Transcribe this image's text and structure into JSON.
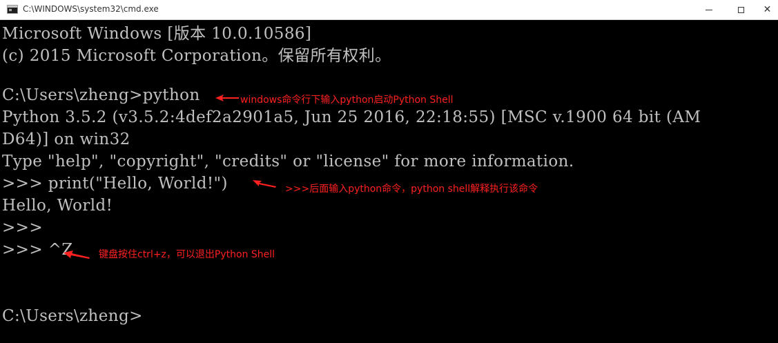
{
  "window": {
    "title": "C:\\WINDOWS\\system32\\cmd.exe",
    "minimize_glyph": "—",
    "maximize_glyph": "☐",
    "close_glyph": "✕"
  },
  "console": {
    "lines": [
      "Microsoft Windows [版本 10.0.10586]",
      "(c) 2015 Microsoft Corporation。保留所有权利。",
      "",
      "C:\\Users\\zheng>python",
      "Python 3.5.2 (v3.5.2:4def2a2901a5, Jun 25 2016, 22:18:55) [MSC v.1900 64 bit (AM",
      "D64)] on win32",
      "Type \"help\", \"copyright\", \"credits\" or \"license\" for more information.",
      ">>> print(\"Hello, World!\")",
      "Hello, World!",
      ">>>",
      ">>> ^Z",
      "",
      "",
      "C:\\Users\\zheng>"
    ]
  },
  "annotations": [
    "windows命令行下输入python启动Python Shell",
    ">>>后面输入python命令，python shell解释执行该命令",
    "键盘按住ctrl+z，可以退出Python Shell"
  ],
  "colors": {
    "console_bg": "#000000",
    "console_text": "#c0c0c0",
    "annotation": "#ff2020"
  }
}
